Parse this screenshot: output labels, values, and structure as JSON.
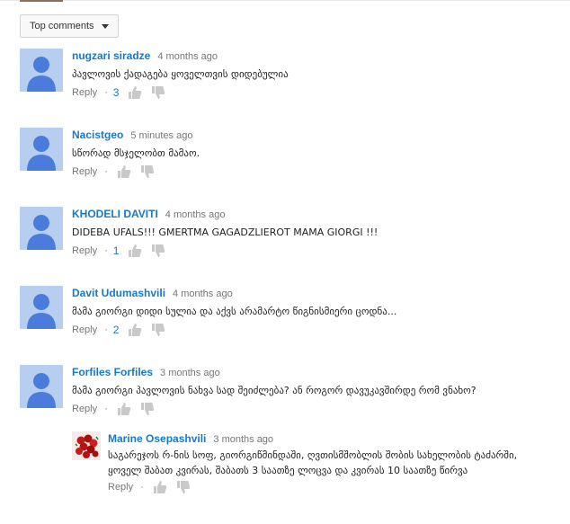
{
  "sort": {
    "label": "Top comments"
  },
  "comments": [
    {
      "author": "nugzari siradze",
      "time": "4 months ago",
      "text": "პავლოვის ქადაგება ყოველთვის დიდებულია",
      "reply": "Reply",
      "likes": "3"
    },
    {
      "author": "Nacistgeo",
      "time": "5 minutes ago",
      "text": "სწორად მსჯელობთ მამაო.",
      "reply": "Reply",
      "likes": ""
    },
    {
      "author": "KHODELI DAVITI",
      "time": "4 months ago",
      "text": "DIDEBA UFALS!!! GMERTMA GAGADZLIEROT MAMA GIORGI !!!",
      "reply": "Reply",
      "likes": "1"
    },
    {
      "author": "Davit Udumashvili",
      "time": "4 months ago",
      "text": "მამა გიორგი დიდი სულია და აქვს არამარტო წიგნისმიერი ცოდნა...",
      "reply": "Reply",
      "likes": "2"
    },
    {
      "author": "Forfiles Forfiles",
      "time": "3 months ago",
      "text": "მამა გიორგი პავლოვის ნახვა სად შეიძლება? ან როგორ დავუკავშირდე რომ ვნახო?",
      "reply": "Reply",
      "likes": ""
    }
  ],
  "reply_comment": {
    "author": "Marine Osepashvili",
    "time": "3 months ago",
    "text_line1": "საგარეჯოს რ-ნის სოფ, გიორგიწმინდაში, ღვთისმშობლის შობის სახელობის ტაძარში,",
    "text_line2": "ყოველ შაბათ კვირას, შაბათს 3 საათზე ლოცვა და კვირას 10 საათზე წირვა",
    "reply": "Reply"
  }
}
